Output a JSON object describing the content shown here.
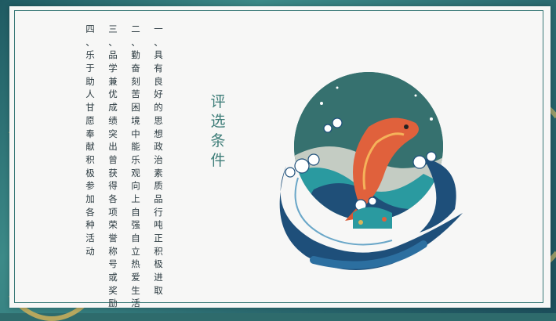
{
  "title_chars": [
    "评",
    "选",
    "条",
    "件"
  ],
  "columns": [
    {
      "id": "col-1",
      "chars": [
        "一",
        "、",
        "具",
        "有",
        "良",
        "好",
        "的",
        "思",
        "想",
        "政",
        "治",
        "素",
        "质",
        "品",
        "行",
        "吨",
        "正",
        "积",
        "极",
        "进",
        "取"
      ]
    },
    {
      "id": "col-2",
      "chars": [
        "二",
        "、",
        "勤",
        "奋",
        "刻",
        "苦",
        "困",
        "境",
        "中",
        "能",
        "乐",
        "观",
        "向",
        "上",
        "自",
        "强",
        "自",
        "立",
        "热",
        "爱",
        "生",
        "活"
      ]
    },
    {
      "id": "col-3",
      "chars": [
        "三",
        "、",
        "品",
        "学",
        "兼",
        "优",
        "成",
        "绩",
        "突",
        "出",
        "曾",
        "获",
        "得",
        "各",
        "项",
        "荣",
        "誉",
        "称",
        "号",
        "或",
        "奖",
        "励"
      ]
    },
    {
      "id": "col-4",
      "chars": [
        "四",
        "、",
        "乐",
        "于",
        "助",
        "人",
        "甘",
        "愿",
        "奉",
        "献",
        "积",
        "极",
        "参",
        "加",
        "各",
        "种",
        "活",
        "动"
      ]
    }
  ],
  "colors": {
    "accent": "#3d7d78",
    "wave_dark": "#1e4f7a",
    "fish": "#e0613c",
    "gold": "#d8b55a"
  }
}
